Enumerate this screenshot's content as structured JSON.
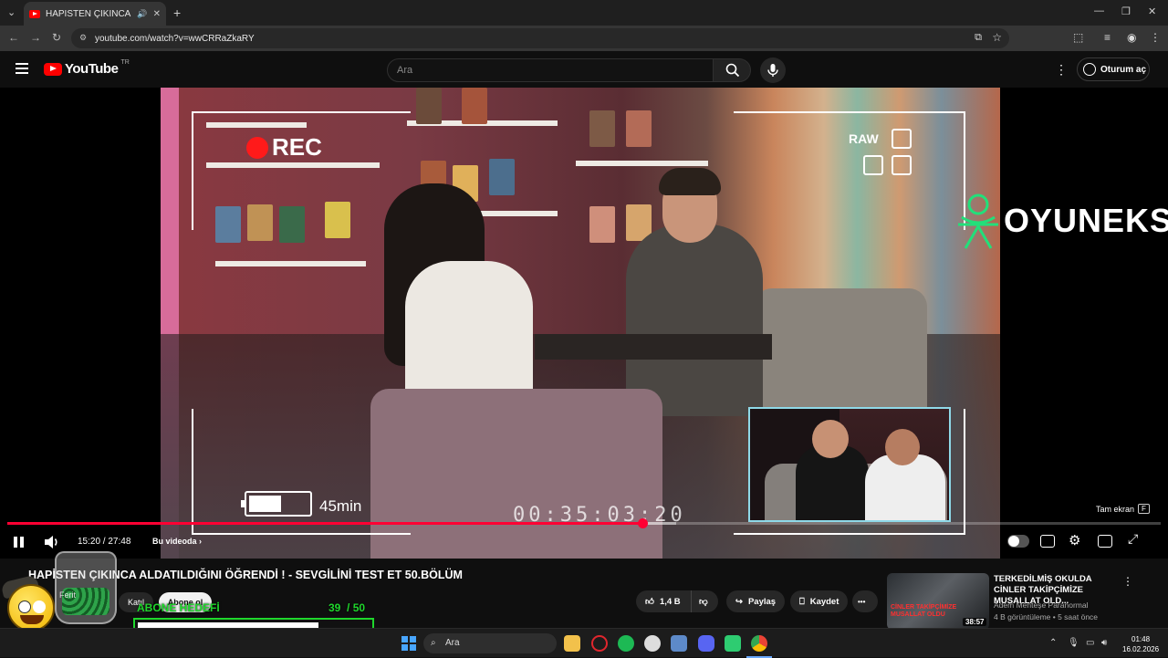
{
  "browser": {
    "tab_title": "HAPİSTEN ÇIKINCA ALDATI",
    "url": "youtube.com/watch?v=wwCRRaZkaRY"
  },
  "youtube": {
    "logo_text": "YouTube",
    "region": "TR",
    "search_placeholder": "Ara",
    "signin_label": "Oturum aç"
  },
  "player": {
    "current_time": "15:20 / 27:48",
    "chapter_label": "Bu videoda",
    "fullscreen_hint": "Tam ekran",
    "fullscreen_key": "F",
    "played_fraction": 0.551,
    "buffered_fraction": 0.58
  },
  "overlay": {
    "rec_label": "REC",
    "raw_label": "RAW",
    "battery_label": "45min",
    "battery_level": 0.55,
    "timecode": "00:35:03:20",
    "brand": "OYUNEKS"
  },
  "video": {
    "title": "HAPİSTEN ÇIKINCA ALDATILDIĞINI ÖĞRENDİ ! - SEVGİLİNİ TEST ET 50.BÖLÜM",
    "join_label": "Katıl",
    "subscribe_label": "Abone ol",
    "likes": "1,4 B",
    "share_label": "Paylaş",
    "save_label": "Kaydet",
    "more_label": "•••"
  },
  "sub_goal": {
    "label": "ABONE HEDEFİ",
    "current": "39",
    "target": "/ 50",
    "fraction": 0.78,
    "jar_name": "Ferit"
  },
  "recommended": {
    "title": "TERKEDİLMİŞ OKULDA CİNLER TAKİPÇİMİZE MUSALLAT OLD...",
    "channel": "Adem Menteşe Paranormal",
    "meta": "4 B görüntüleme • 5 saat önce",
    "duration": "38:57",
    "thumb_text": "CİNLER TAKİPÇİMİZE MUSALLAT OLDU"
  },
  "taskbar": {
    "search_label": "Ara",
    "time": "01:48",
    "date": "16.02.2026"
  }
}
